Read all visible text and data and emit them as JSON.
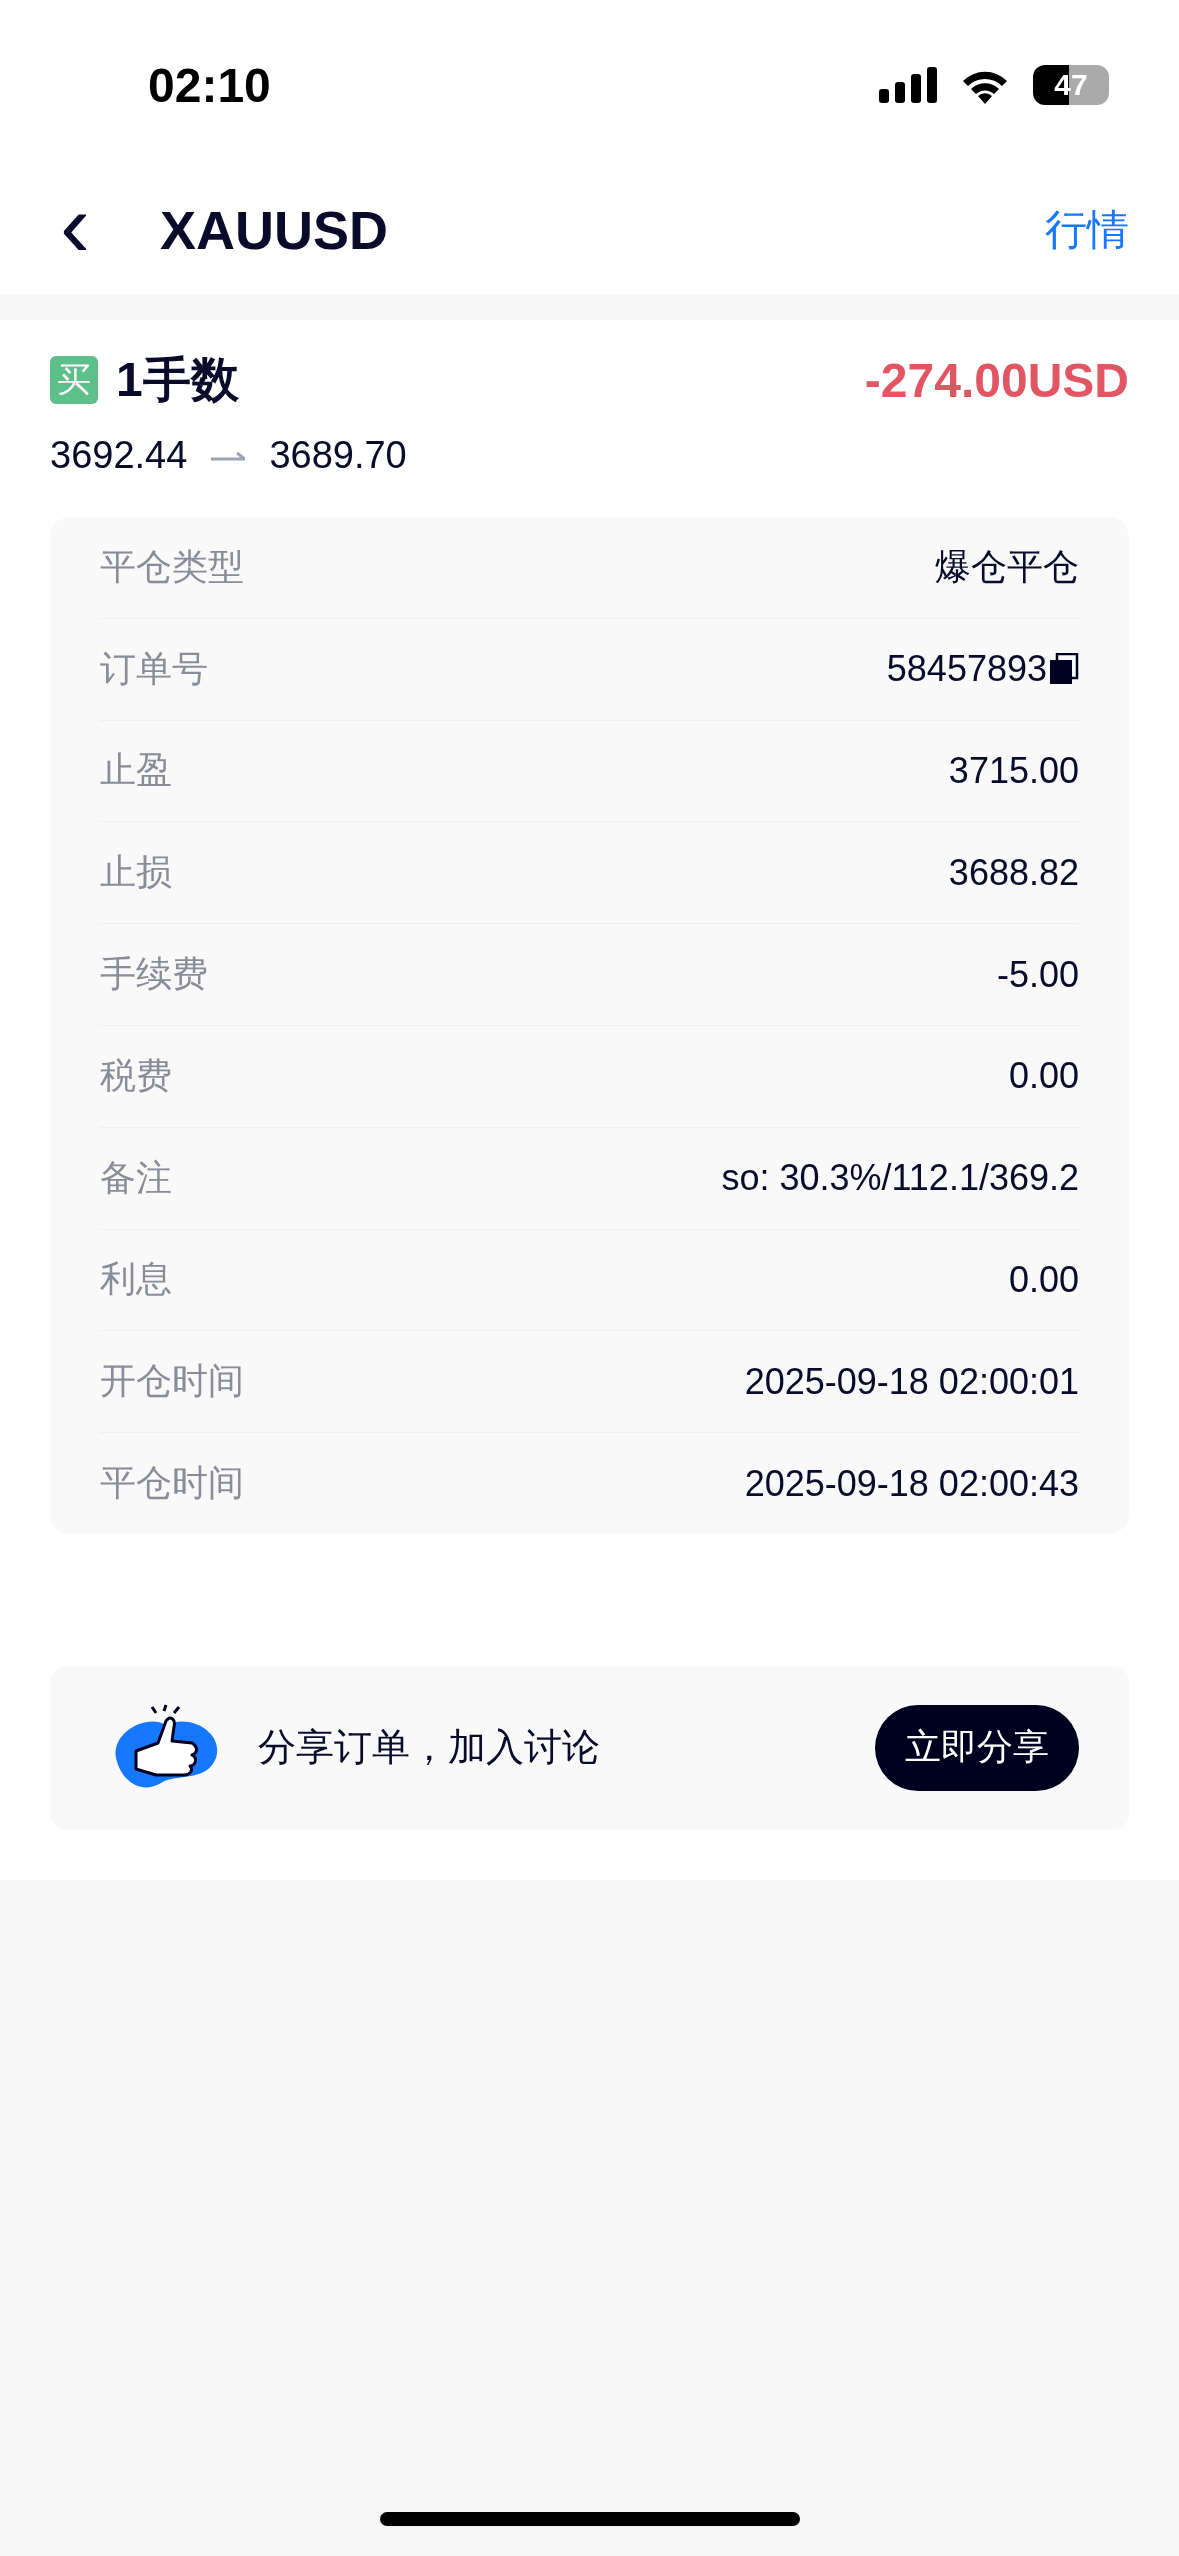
{
  "status_bar": {
    "time": "02:10",
    "battery": "47"
  },
  "nav": {
    "back": "‹",
    "title": "XAUUSD",
    "action": "行情"
  },
  "position": {
    "side_label": "买",
    "lots": "1手数",
    "profit": "-274.00USD",
    "open_price": "3692.44",
    "close_price": "3689.70"
  },
  "details": [
    {
      "kind": "text",
      "label": "平仓类型",
      "value": "爆仓平仓"
    },
    {
      "kind": "copyable",
      "label": "订单号",
      "value": "58457893"
    },
    {
      "kind": "text",
      "label": "止盈",
      "value": "3715.00"
    },
    {
      "kind": "text",
      "label": "止损",
      "value": "3688.82"
    },
    {
      "kind": "text",
      "label": "手续费",
      "value": "-5.00"
    },
    {
      "kind": "text",
      "label": "税费",
      "value": "0.00"
    },
    {
      "kind": "text",
      "label": "备注",
      "value": "so: 30.3%/112.1/369.2"
    },
    {
      "kind": "text",
      "label": "利息",
      "value": "0.00"
    },
    {
      "kind": "text",
      "label": "开仓时间",
      "value": "2025-09-18 02:00:01"
    },
    {
      "kind": "text",
      "label": "平仓时间",
      "value": "2025-09-18 02:00:43"
    }
  ],
  "share": {
    "text": "分享订单，加入讨论",
    "button": "立即分享"
  }
}
